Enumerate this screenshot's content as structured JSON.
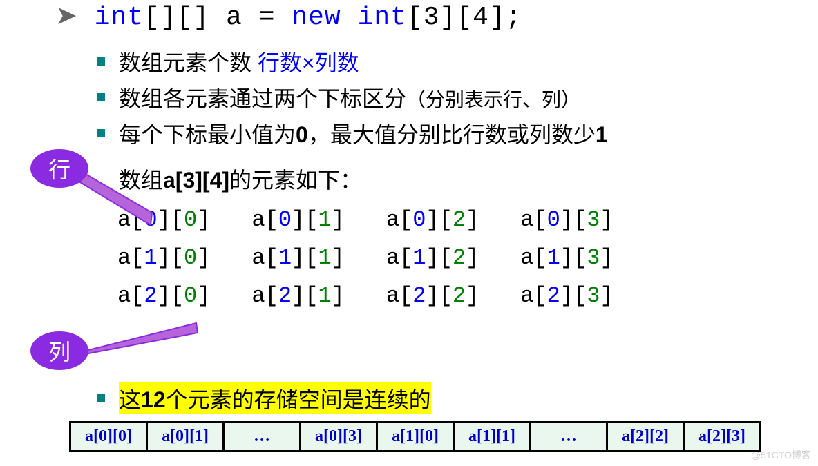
{
  "code_decl": {
    "arrow": "➤",
    "c1": "int",
    "c2": "[][] a = ",
    "c3": "new",
    "c4": " int",
    "c5": "[3][4];"
  },
  "bullets": {
    "b1a": "数组元素个数 ",
    "b1b": "行数×列数",
    "b2a": "数组各元素通过两个下标区分",
    "b2b": "（分别表示行、列）",
    "b3a": "每个下标最小值为",
    "b3b": "0",
    "b3c": "，最大值分别比行数或列数少",
    "b3d": "1",
    "b4a": "数组",
    "b4b": "a[3][4]",
    "b4c": "的元素如下：",
    "b5a": "这",
    "b5b": "12",
    "b5c": "个元素的存储空间是连续的"
  },
  "labels": {
    "row": "行",
    "col": "列"
  },
  "grid": [
    [
      {
        "r": "0",
        "c": "0"
      },
      {
        "r": "0",
        "c": "1"
      },
      {
        "r": "0",
        "c": "2"
      },
      {
        "r": "0",
        "c": "3"
      }
    ],
    [
      {
        "r": "1",
        "c": "0"
      },
      {
        "r": "1",
        "c": "1"
      },
      {
        "r": "1",
        "c": "2"
      },
      {
        "r": "1",
        "c": "3"
      }
    ],
    [
      {
        "r": "2",
        "c": "0"
      },
      {
        "r": "2",
        "c": "1"
      },
      {
        "r": "2",
        "c": "2"
      },
      {
        "r": "2",
        "c": "3"
      }
    ]
  ],
  "memory": [
    "a[0][0]",
    "a[0][1]",
    "…",
    "a[0][3]",
    "a[1][0]",
    "a[1][1]",
    "…",
    "a[2][2]",
    "a[2][3]"
  ],
  "watermark": "@51CTO博客"
}
